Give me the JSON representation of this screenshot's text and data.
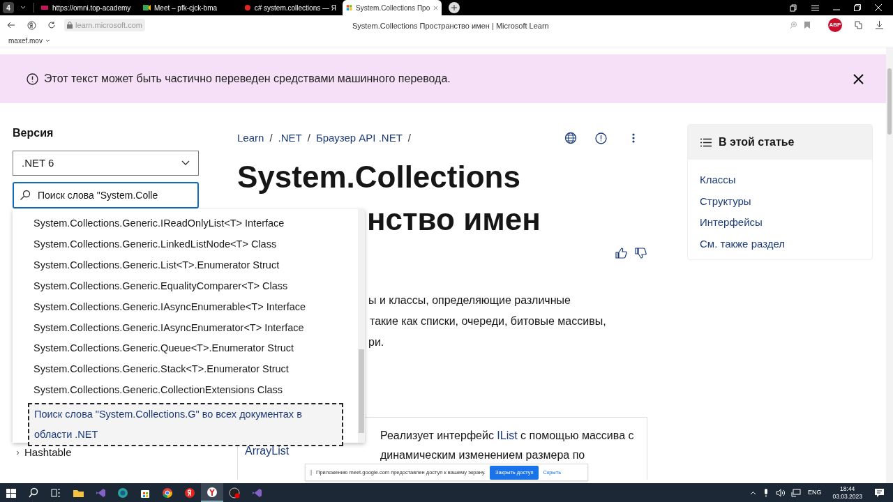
{
  "browser": {
    "tab_count": "4",
    "tabs": [
      {
        "title": "https://omni.top-academy",
        "selected": false
      },
      {
        "title": "Meet – pfk-cjck-bma",
        "selected": false
      },
      {
        "title": "c# system.collections — Я",
        "selected": false
      },
      {
        "title": "System.Collections Про",
        "selected": true
      }
    ],
    "address": "learn.microsoft.com",
    "page_title": "System.Collections Пространство имен | Microsoft Learn",
    "profile": "maxef.mov",
    "extension_badge": "ABP"
  },
  "banner": {
    "text": "Этот текст может быть частично переведен средствами машинного перевода."
  },
  "sidebar": {
    "version_label": "Версия",
    "version": ".NET 6",
    "search_value": "Поиск слова \"System.Colle",
    "tree_items": [
      "Hashtable"
    ]
  },
  "suggestions": {
    "items": [
      "System.Collections.Generic.IReadOnlyList<T> Interface",
      "System.Collections.Generic.LinkedListNode<T> Class",
      "System.Collections.Generic.List<T>.Enumerator Struct",
      "System.Collections.Generic.EqualityComparer<T> Class",
      "System.Collections.Generic.IAsyncEnumerable<T> Interface",
      "System.Collections.Generic.IAsyncEnumerator<T> Interface",
      "System.Collections.Generic.Queue<T>.Enumerator Struct",
      "System.Collections.Generic.Stack<T>.Enumerator Struct",
      "System.Collections.Generic.CollectionExtensions Class"
    ],
    "search_all": "Поиск слова \"System.Collections.G\" во всех документах в области .NET"
  },
  "breadcrumbs": [
    {
      "label": "Learn",
      "separator": "/"
    },
    {
      "label": ".NET",
      "separator": "/"
    },
    {
      "label": "Браузер API .NET",
      "separator": "/"
    }
  ],
  "title_line_1": "System.Collections",
  "title_line_2": "нство имен",
  "summary_lines": [
    "ы и классы, определяющие различные",
    "такие как списки, очереди, битовые массивы,",
    "ри."
  ],
  "table": {
    "rows": [
      {
        "name": "ArrayList",
        "text_before": "Реализует интерфейс ",
        "link": "IList",
        "text_after": " с помощью массива с",
        "text_line_2": "динамическим изменением размера по"
      }
    ]
  },
  "toc": {
    "title": "В этой статье",
    "items": [
      "Классы",
      "Структуры",
      "Интерфейсы",
      "См. также раздел"
    ]
  },
  "share_notice": {
    "text": "Приложению meet.google.com предоставлен доступ к вашему экрану.",
    "stop_button": "Закрыть доступ",
    "hide_link": "Скрыть"
  },
  "taskbar": {
    "language": "ENG",
    "time": "18:44",
    "date": "03.03.2023"
  }
}
